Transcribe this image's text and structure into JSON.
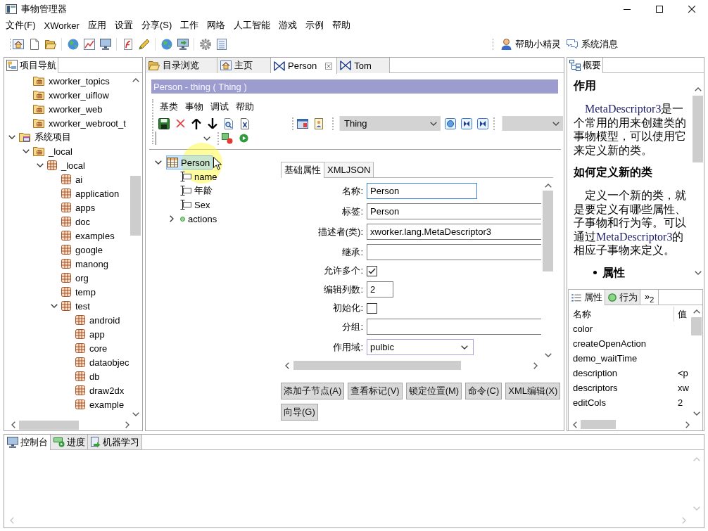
{
  "window": {
    "title": "事物管理器"
  },
  "menu": [
    "文件(F)",
    "XWorker",
    "应用",
    "设置",
    "分享(S)",
    "工作",
    "网络",
    "人工智能",
    "游戏",
    "示例",
    "帮助"
  ],
  "toolbar_links": [
    {
      "label": "帮助小精灵",
      "kind": "person"
    },
    {
      "label": "系统消息",
      "kind": "chat"
    }
  ],
  "navigator": {
    "tab": "项目导航",
    "tree": [
      {
        "children": [
          {
            "label": "xworker_topics",
            "kind": "project"
          },
          {
            "label": "xworker_uiflow",
            "kind": "project"
          },
          {
            "label": "xworker_web",
            "kind": "project"
          },
          {
            "label": "xworker_webroot_t",
            "kind": "project"
          }
        ]
      },
      {
        "label": "系统项目",
        "kind": "system",
        "expanded": true,
        "children": [
          {
            "label": "_local",
            "kind": "project",
            "expanded": true,
            "children": [
              {
                "label": "_local",
                "kind": "package",
                "expanded": true,
                "children": [
                  {
                    "label": "ai",
                    "kind": "package"
                  },
                  {
                    "label": "application",
                    "kind": "package"
                  },
                  {
                    "label": "apps",
                    "kind": "package"
                  },
                  {
                    "label": "doc",
                    "kind": "package"
                  },
                  {
                    "label": "examples",
                    "kind": "package"
                  },
                  {
                    "label": "google",
                    "kind": "package"
                  },
                  {
                    "label": "manong",
                    "kind": "package"
                  },
                  {
                    "label": "org",
                    "kind": "package"
                  },
                  {
                    "label": "temp",
                    "kind": "package"
                  },
                  {
                    "label": "test",
                    "kind": "package",
                    "expanded": true,
                    "children": [
                      {
                        "label": "android",
                        "kind": "package"
                      },
                      {
                        "label": "app",
                        "kind": "package"
                      },
                      {
                        "label": "core",
                        "kind": "package"
                      },
                      {
                        "label": "dataobjec",
                        "kind": "package"
                      },
                      {
                        "label": "db",
                        "kind": "package"
                      },
                      {
                        "label": "draw2dx",
                        "kind": "package"
                      },
                      {
                        "label": "example",
                        "kind": "package"
                      }
                    ]
                  }
                ]
              }
            ]
          }
        ]
      }
    ]
  },
  "editor": {
    "tabs": [
      {
        "label": "目录浏览",
        "kind": "folder",
        "selected": false
      },
      {
        "label": "主页",
        "kind": "home",
        "selected": false
      },
      {
        "label": "Person",
        "kind": "thing",
        "selected": true
      },
      {
        "label": "Tom",
        "kind": "thing",
        "selected": false
      }
    ],
    "title": "Person - thing ( Thing )",
    "menu": [
      "基类",
      "事物",
      "调试",
      "帮助"
    ],
    "class_combo": "Thing",
    "tree": [
      {
        "label": "Person",
        "kind": "class",
        "expanded": true,
        "selected": true,
        "children": [
          {
            "label": "name",
            "kind": "attribute",
            "selected": false
          },
          {
            "label": "年龄",
            "kind": "attribute",
            "selected": false
          },
          {
            "label": "Sex",
            "kind": "attribute",
            "selected": false
          },
          {
            "label": "actions",
            "kind": "actions",
            "expanded": false,
            "selected": false
          }
        ]
      }
    ],
    "form_tabs": [
      {
        "label": "基础属性",
        "selected": true
      },
      {
        "label": "XMLJSON",
        "selected": false
      }
    ],
    "fields": [
      {
        "label": "名称:",
        "kind": "text-medium",
        "value": "Person",
        "focused": true
      },
      {
        "label": "标签:",
        "kind": "text",
        "value": "Person",
        "focused": false
      },
      {
        "label": "描述者(类):",
        "kind": "text",
        "value": "xworker.lang.MetaDescriptor3",
        "focused": false
      },
      {
        "label": "继承:",
        "kind": "text",
        "focused": false
      },
      {
        "label": "允许多个:",
        "kind": "checkbox",
        "checked": true
      },
      {
        "label": "编辑列数:",
        "kind": "number",
        "value": "2",
        "focused": false
      },
      {
        "label": "初始化:",
        "kind": "checkbox",
        "checked": false
      },
      {
        "label": "分组:",
        "kind": "text",
        "focused": false
      },
      {
        "label": "作用域:",
        "kind": "select",
        "value": "pulbic",
        "focused": false
      }
    ],
    "button_rows": [
      [
        "添加子节点(A)",
        "查看标记(V)",
        "锁定位置(M)",
        "命令(C)",
        "XML编辑(X)"
      ],
      [
        "向导(G)"
      ]
    ]
  },
  "outline": {
    "tab": "概要",
    "doc": [
      {
        "kind": "heading",
        "text": "作用"
      },
      {
        "kind": "paragraph",
        "segments": [
          {
            "kind": "term",
            "text": "MetaDescriptor3"
          },
          {
            "kind": "plain",
            "text": "是一个常用的用来创建类的事物模型，可以使用它来定义新的类。"
          }
        ]
      },
      {
        "kind": "heading",
        "text": "如何定义新的类"
      },
      {
        "kind": "paragraph",
        "segments": [
          {
            "kind": "plain",
            "text": "定义一个新的类，就是要定义有哪些属性、子事物和行为等。可以通过"
          },
          {
            "kind": "term",
            "text": "MetaDescriptor3"
          },
          {
            "kind": "plain",
            "text": "的相应子事物来定义。"
          }
        ]
      },
      {
        "kind": "bullet",
        "text": "属性"
      }
    ]
  },
  "properties": {
    "tabs": [
      {
        "label": "属性",
        "kind": "list",
        "selected": true
      },
      {
        "label": "行为",
        "kind": "action",
        "selected": false
      }
    ],
    "overflow": "»$_{2}$",
    "columns": [
      "名称",
      "值"
    ],
    "rows": [
      {
        "name": "color"
      },
      {
        "name": "createOpenAction"
      },
      {
        "name": "demo_waitTime"
      },
      {
        "name": "description",
        "value": "<p"
      },
      {
        "name": "descriptors",
        "value": "xw"
      },
      {
        "name": "editCols",
        "value": "2"
      }
    ]
  },
  "console": {
    "tabs": [
      {
        "label": "控制台",
        "kind": "monitor",
        "selected": true
      },
      {
        "label": "进度",
        "kind": "progress",
        "selected": false
      },
      {
        "label": "机器学习",
        "kind": "learning",
        "selected": false
      }
    ]
  }
}
